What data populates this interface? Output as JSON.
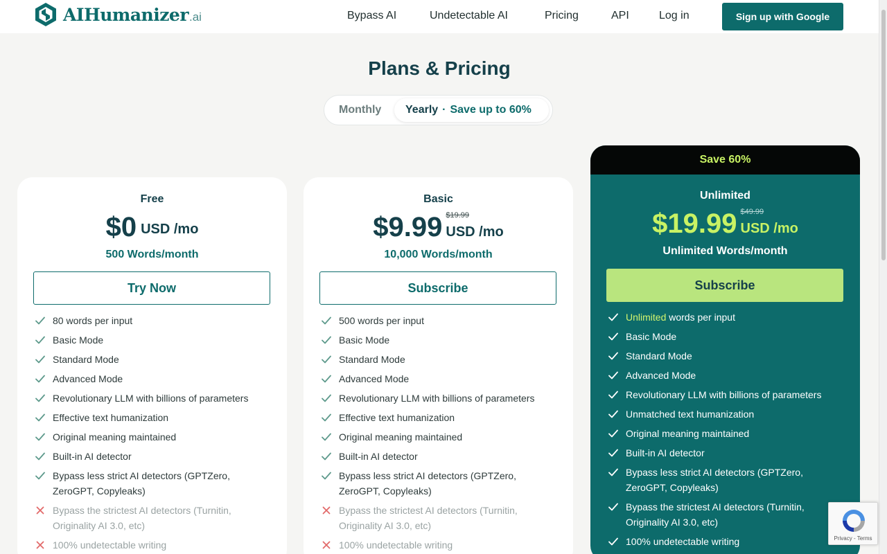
{
  "header": {
    "logo_text": "AIHumanizer",
    "logo_suffix": ".ai",
    "nav": [
      "Bypass AI",
      "Undetectable AI",
      "Pricing",
      "API",
      "Log in"
    ],
    "signup": "Sign up with Google"
  },
  "page_title": "Plans & Pricing",
  "billing_toggle": {
    "monthly": "Monthly",
    "yearly": "Yearly",
    "separator": "·",
    "save": "Save up to 60%",
    "selected": "Yearly"
  },
  "plans": [
    {
      "name": "Free",
      "price": "$0",
      "unit": "USD /mo",
      "words": "500 Words/month",
      "cta": "Try Now",
      "features": [
        {
          "text": "80 words per input",
          "included": true
        },
        {
          "text": "Basic Mode",
          "included": true
        },
        {
          "text": "Standard Mode",
          "included": true
        },
        {
          "text": "Advanced Mode",
          "included": true
        },
        {
          "text": "Revolutionary LLM with billions of parameters",
          "included": true
        },
        {
          "text": "Effective text humanization",
          "included": true
        },
        {
          "text": "Original meaning maintained",
          "included": true
        },
        {
          "text": "Built-in AI detector",
          "included": true
        },
        {
          "text": "Bypass less strict AI detectors (GPTZero, ZeroGPT, Copyleaks)",
          "included": true
        },
        {
          "text": "Bypass the strictest AI detectors (Turnitin, Originality AI 3.0, etc)",
          "included": false
        },
        {
          "text": "100% undetectable writing",
          "included": false
        }
      ]
    },
    {
      "name": "Basic",
      "price": "$9.99",
      "old_price": "$19.99",
      "unit": "USD /mo",
      "words": "10,000 Words/month",
      "cta": "Subscribe",
      "features": [
        {
          "text": "500 words per input",
          "included": true
        },
        {
          "text": "Basic Mode",
          "included": true
        },
        {
          "text": "Standard Mode",
          "included": true
        },
        {
          "text": "Advanced Mode",
          "included": true
        },
        {
          "text": "Revolutionary LLM with billions of parameters",
          "included": true
        },
        {
          "text": "Effective text humanization",
          "included": true
        },
        {
          "text": "Original meaning maintained",
          "included": true
        },
        {
          "text": "Built-in AI detector",
          "included": true
        },
        {
          "text": "Bypass less strict AI detectors (GPTZero, ZeroGPT, Copyleaks)",
          "included": true
        },
        {
          "text": "Bypass the strictest AI detectors (Turnitin, Originality AI 3.0, etc)",
          "included": false
        },
        {
          "text": "100% undetectable writing",
          "included": false
        }
      ]
    },
    {
      "name": "Unlimited",
      "banner": "Save 60%",
      "price": "$19.99",
      "old_price": "$49.99",
      "unit": "USD /mo",
      "words": "Unlimited Words/month",
      "cta": "Subscribe",
      "features": [
        {
          "highlight": "Unlimited",
          "text": " words per input",
          "included": true
        },
        {
          "text": "Basic Mode",
          "included": true
        },
        {
          "text": "Standard Mode",
          "included": true
        },
        {
          "text": "Advanced Mode",
          "included": true
        },
        {
          "text": "Revolutionary LLM with billions of parameters",
          "included": true
        },
        {
          "text": "Unmatched text humanization",
          "included": true
        },
        {
          "text": "Original meaning maintained",
          "included": true
        },
        {
          "text": "Built-in AI detector",
          "included": true
        },
        {
          "text": "Bypass less strict AI detectors (GPTZero, ZeroGPT, Copyleaks)",
          "included": true
        },
        {
          "text": "Bypass the strictest AI detectors (Turnitin, Originality AI 3.0, etc)",
          "included": true
        },
        {
          "text": "100% undetectable writing",
          "included": true
        }
      ]
    }
  ],
  "recaptcha": {
    "links": "Privacy - Terms"
  },
  "colors": {
    "brand": "#0d6b6b",
    "accent": "#c8f264",
    "cta_light": "#b9e57e",
    "banner": "#050706"
  },
  "icons": {
    "included": "check-icon",
    "excluded": "cross-icon"
  }
}
